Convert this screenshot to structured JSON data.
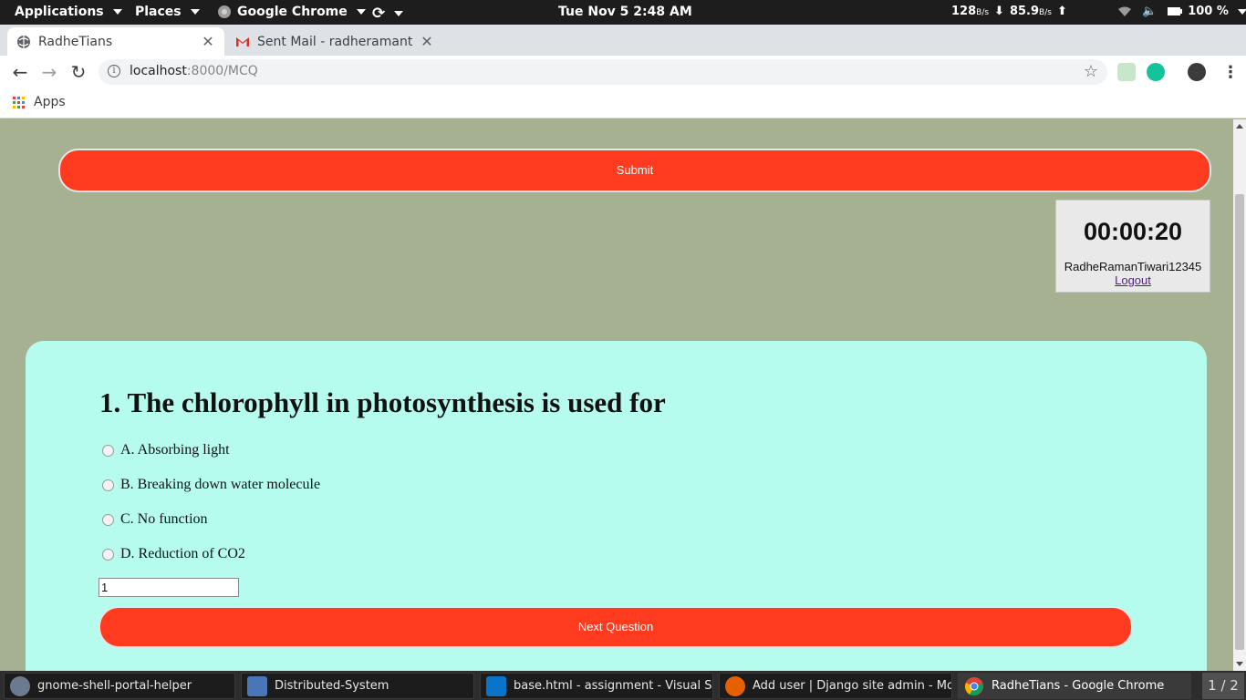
{
  "topbar": {
    "applications": "Applications",
    "places": "Places",
    "app_name": "Google Chrome",
    "datetime": "Tue Nov 5  2:48 AM",
    "net_down_value": "128",
    "net_down_unit": "B/s",
    "net_up_value": "85.9",
    "net_up_unit": "B/s",
    "battery": "100 %"
  },
  "tabs": [
    {
      "title": "RadheTians",
      "active": true
    },
    {
      "title": "Sent Mail - radheramantiw",
      "active": false
    }
  ],
  "toolbar": {
    "url_host": "localhost",
    "url_rest": ":8000/MCQ"
  },
  "bookmarks": {
    "apps_label": "Apps"
  },
  "page": {
    "submit_label": "Submit",
    "timer": "00:00:20",
    "username": "RadheRamanTiwari12345",
    "logout_label": "Logout",
    "question": "1. The chlorophyll in photosynthesis is used for",
    "options": [
      "A. Absorbing light",
      "B. Breaking down water molecule",
      "C. No function",
      "D. Reduction of CO2"
    ],
    "answer_value": "1",
    "next_label": "Next Question"
  },
  "taskbar": {
    "items": [
      "gnome-shell-portal-helper",
      "Distributed-System",
      "base.html - assignment - Visual Studio Code",
      "Add user | Django site admin - Mozilla Firefox",
      "RadheTians - Google Chrome"
    ],
    "pager": "1 / 2"
  },
  "colors": {
    "page_bg": "#a5b191",
    "button_red": "#ff3b1f",
    "card_bg": "#b6fcee"
  }
}
